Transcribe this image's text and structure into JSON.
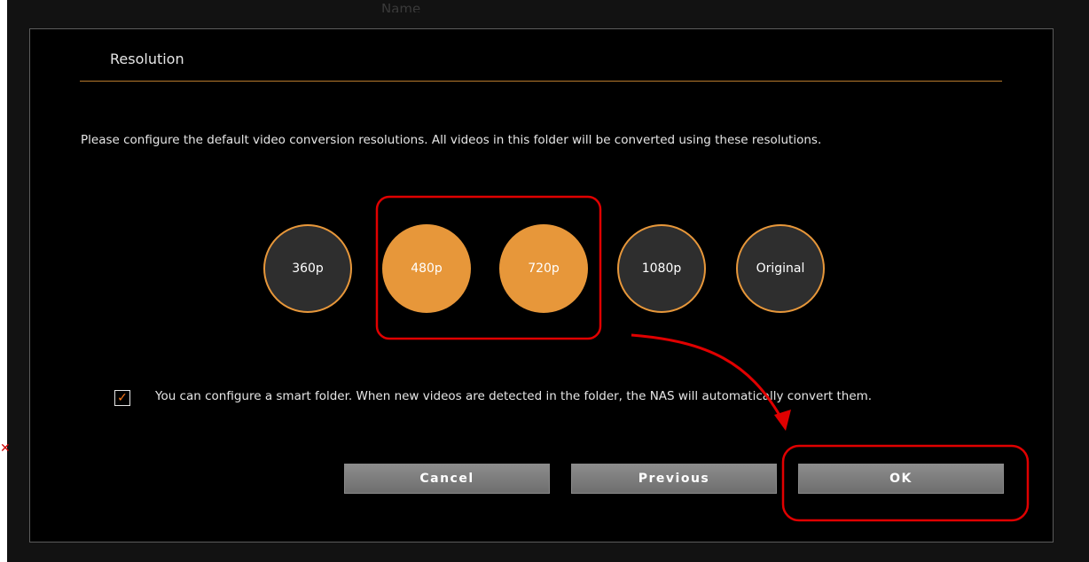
{
  "background_label": "Name",
  "dialog": {
    "title": "Resolution",
    "description": "Please configure the default video conversion resolutions. All videos in this folder will be converted using these resolutions.",
    "resolutions": [
      {
        "label": "360p",
        "selected": false
      },
      {
        "label": "480p",
        "selected": true
      },
      {
        "label": "720p",
        "selected": true
      },
      {
        "label": "1080p",
        "selected": false
      },
      {
        "label": "Original",
        "selected": false
      }
    ],
    "smart_folder": {
      "checked": true,
      "check_glyph": "✓",
      "text": "You can configure a smart folder. When new videos are detected in the folder, the NAS will automatically convert them."
    },
    "buttons": {
      "cancel": "Cancel",
      "previous": "Previous",
      "ok": "OK"
    }
  },
  "colors": {
    "accent": "#e7973a",
    "annotation": "#e00000",
    "dialog_bg": "#000000",
    "button": "#7a7a7a"
  }
}
